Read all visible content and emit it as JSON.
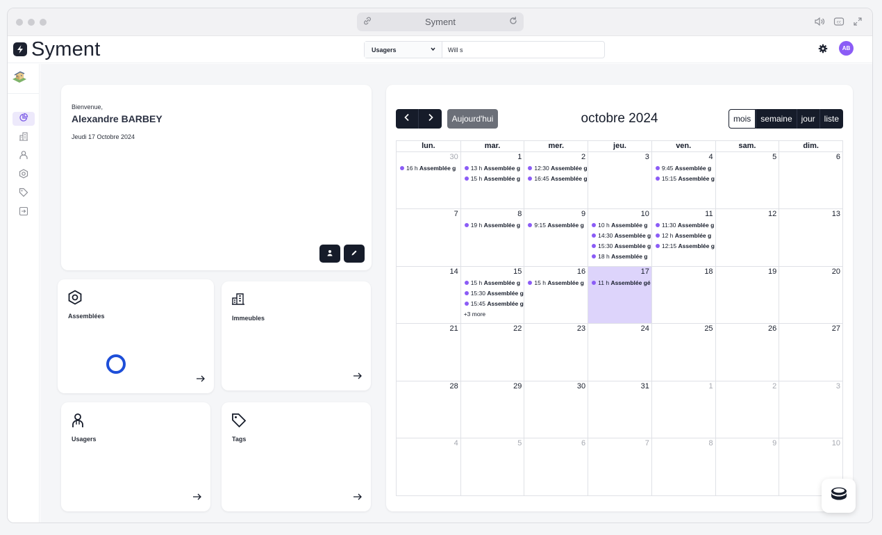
{
  "browser": {
    "address_text": "Syment"
  },
  "header": {
    "brand": "Syment",
    "search": {
      "select_value": "Usagers",
      "query": "Will s"
    },
    "avatar_initials": "AB"
  },
  "welcome": {
    "greeting": "Bienvenue,",
    "name": "Alexandre BARBEY",
    "date": "Jeudi 17 Octobre 2024"
  },
  "tiles": {
    "assemblees": "Assemblées",
    "immeubles": "Immeubles",
    "usagers": "Usagers",
    "tags": "Tags"
  },
  "calendar": {
    "title": "octobre 2024",
    "today_label": "Aujourd'hui",
    "views": [
      "mois",
      "semaine",
      "jour",
      "liste"
    ],
    "active_view": "mois",
    "event_color": "#8b5cf6",
    "today_highlight": "#ddd4fb",
    "weekdays": [
      "lun.",
      "mar.",
      "mer.",
      "jeu.",
      "ven.",
      "sam.",
      "dim."
    ],
    "weeks": [
      [
        {
          "n": "30",
          "other": true,
          "events": [
            {
              "time": "16 h",
              "title": "Assemblée g"
            }
          ]
        },
        {
          "n": "1",
          "events": [
            {
              "time": "13 h",
              "title": "Assemblée g"
            },
            {
              "time": "15 h",
              "title": "Assemblée g"
            }
          ]
        },
        {
          "n": "2",
          "events": [
            {
              "time": "12:30",
              "title": "Assemblée g"
            },
            {
              "time": "16:45",
              "title": "Assemblée g"
            }
          ]
        },
        {
          "n": "3",
          "events": []
        },
        {
          "n": "4",
          "events": [
            {
              "time": "9:45",
              "title": "Assemblée g"
            },
            {
              "time": "15:15",
              "title": "Assemblée g"
            }
          ]
        },
        {
          "n": "5",
          "events": []
        },
        {
          "n": "6",
          "events": []
        }
      ],
      [
        {
          "n": "7",
          "events": []
        },
        {
          "n": "8",
          "events": [
            {
              "time": "19 h",
              "title": "Assemblée g"
            }
          ]
        },
        {
          "n": "9",
          "events": [
            {
              "time": "9:15",
              "title": "Assemblée g"
            }
          ]
        },
        {
          "n": "10",
          "events": [
            {
              "time": "10 h",
              "title": "Assemblée g"
            },
            {
              "time": "14:30",
              "title": "Assemblée g"
            },
            {
              "time": "15:30",
              "title": "Assemblée g"
            },
            {
              "time": "18 h",
              "title": "Assemblée g"
            }
          ]
        },
        {
          "n": "11",
          "events": [
            {
              "time": "11:30",
              "title": "Assemblée g"
            },
            {
              "time": "12 h",
              "title": "Assemblée g"
            },
            {
              "time": "12:15",
              "title": "Assemblée g"
            }
          ]
        },
        {
          "n": "12",
          "events": []
        },
        {
          "n": "13",
          "events": []
        }
      ],
      [
        {
          "n": "14",
          "events": []
        },
        {
          "n": "15",
          "events": [
            {
              "time": "15 h",
              "title": "Assemblée g"
            },
            {
              "time": "15:30",
              "title": "Assemblée g"
            },
            {
              "time": "15:45",
              "title": "Assemblée g"
            }
          ],
          "more": "+3 more"
        },
        {
          "n": "16",
          "events": [
            {
              "time": "15 h",
              "title": "Assemblée g"
            }
          ]
        },
        {
          "n": "17",
          "today": true,
          "events": [
            {
              "time": "11 h",
              "title": "Assemblée gé"
            }
          ]
        },
        {
          "n": "18",
          "events": []
        },
        {
          "n": "19",
          "events": []
        },
        {
          "n": "20",
          "events": []
        }
      ],
      [
        {
          "n": "21",
          "events": []
        },
        {
          "n": "22",
          "events": []
        },
        {
          "n": "23",
          "events": []
        },
        {
          "n": "24",
          "events": []
        },
        {
          "n": "25",
          "events": []
        },
        {
          "n": "26",
          "events": []
        },
        {
          "n": "27",
          "events": []
        }
      ],
      [
        {
          "n": "28",
          "events": []
        },
        {
          "n": "29",
          "events": []
        },
        {
          "n": "30",
          "events": []
        },
        {
          "n": "31",
          "events": []
        },
        {
          "n": "1",
          "other": true,
          "events": []
        },
        {
          "n": "2",
          "other": true,
          "events": []
        },
        {
          "n": "3",
          "other": true,
          "events": []
        }
      ],
      [
        {
          "n": "4",
          "other": true,
          "events": []
        },
        {
          "n": "5",
          "other": true,
          "events": []
        },
        {
          "n": "6",
          "other": true,
          "events": []
        },
        {
          "n": "7",
          "other": true,
          "events": []
        },
        {
          "n": "8",
          "other": true,
          "events": []
        },
        {
          "n": "9",
          "other": true,
          "events": []
        },
        {
          "n": "10",
          "other": true,
          "events": []
        }
      ]
    ]
  }
}
